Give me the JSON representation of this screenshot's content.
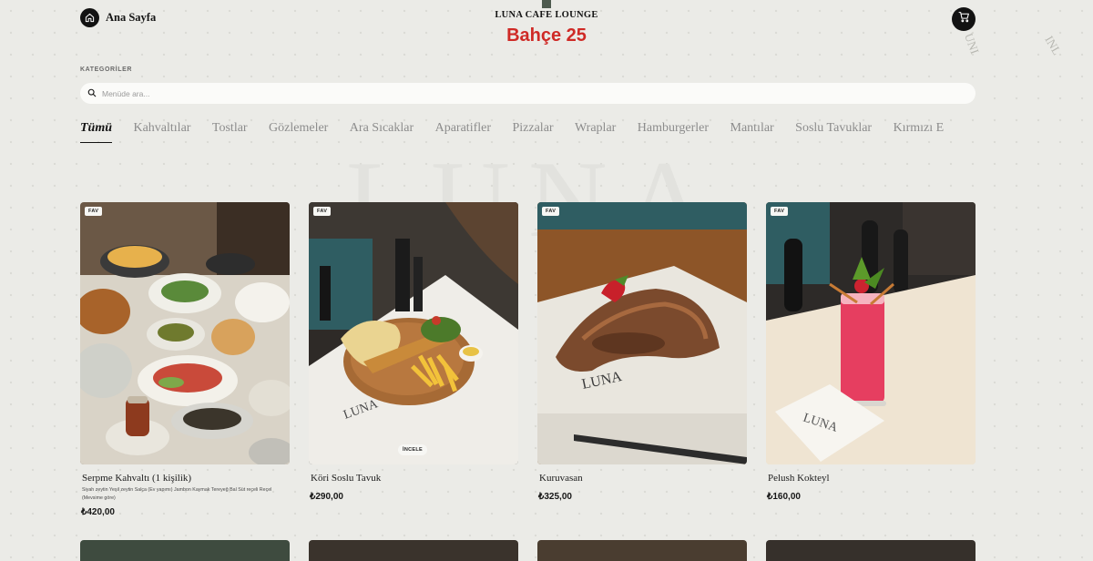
{
  "header": {
    "home_label": "Ana Sayfa",
    "brand_name": "LUNA CAFE LOUNGE",
    "table_name": "Bahçe 25",
    "home_icon": "home-icon",
    "cart_icon": "cart-icon"
  },
  "categories": {
    "title": "KATEGORİLER",
    "search_placeholder": "Menüde ara...",
    "tabs": [
      "Tümü",
      "Kahvaltılar",
      "Tostlar",
      "Gözlemeler",
      "Ara Sıcaklar",
      "Aparatifler",
      "Pizzalar",
      "Wraplar",
      "Hamburgerler",
      "Mantılar",
      "Soslu Tavuklar",
      "Kırmızı E"
    ],
    "active_tab": 0
  },
  "products": [
    {
      "name": "Serpme Kahvaltı (1 kişilik)",
      "desc": "Siyah zeytin Yeşil zeytin Salça (Ev yapımı) Jambon Kaymak Tereyeğ Bal Süt reçeli Reçel (Mevsime göre)",
      "price": "₺420,00",
      "badge": "FAV"
    },
    {
      "name": "Köri Soslu Tavuk",
      "desc": "",
      "price": "₺290,00",
      "badge": "FAV",
      "action": "İNCELE"
    },
    {
      "name": "Kuruvasan",
      "desc": "",
      "price": "₺325,00",
      "badge": "FAV"
    },
    {
      "name": "Pelush Kokteyl",
      "desc": "",
      "price": "₺160,00",
      "badge": "FAV"
    }
  ],
  "colors": {
    "accent_red": "#cf2a26",
    "background": "#ebebe7",
    "dark": "#121212"
  }
}
